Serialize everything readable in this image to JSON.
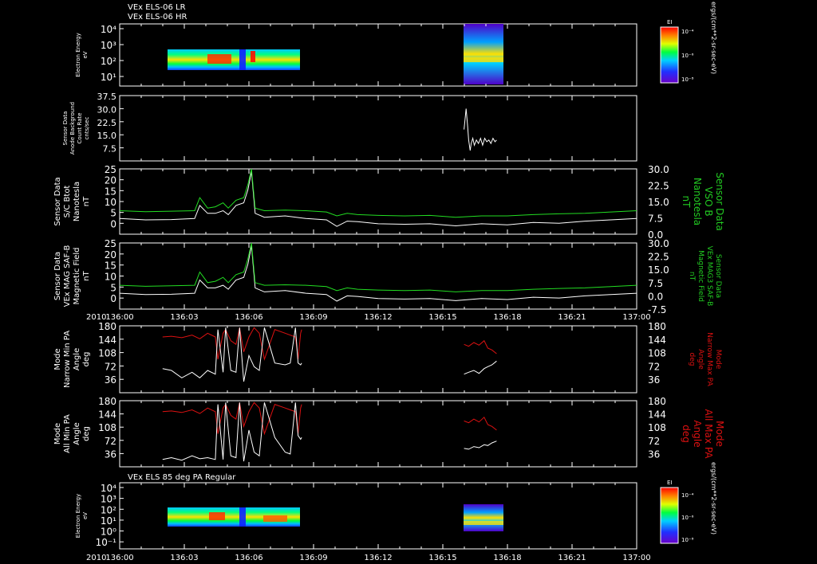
{
  "header": {
    "line1": "VEx ELS-06 LR",
    "line2": "VEx ELS-06 HR",
    "bottom_panel_title": "VEx ELS 85 deg PA Regular",
    "year": "2010"
  },
  "colors": {
    "background": "#000000",
    "axis": "#ffffff",
    "white_trace": "#ffffff",
    "green_trace": "#22dd22",
    "red_trace": "#dd1111",
    "green_label": "#22cc22",
    "red_label": "#dd1111"
  },
  "time_axis": {
    "ticks": [
      "136:00",
      "136:03",
      "136:06",
      "136:09",
      "136:12",
      "136:15",
      "136:18",
      "136:21",
      "137:00"
    ]
  },
  "colorbar": {
    "title": "EI",
    "ticks": [
      "10⁻⁴",
      "10⁻⁶",
      "10⁻⁸"
    ],
    "units": "ergs/(cm**2-sr-sec-eV)"
  },
  "chart_data": [
    {
      "type": "heatmap",
      "id": "els-lr-hr",
      "ylabel": [
        "Electron Energy",
        "eV"
      ],
      "yticks": [
        "10⁴",
        "10³",
        "10²",
        "10¹"
      ],
      "blocks": [
        {
          "t_start": 0.083,
          "t_end": 0.352,
          "note": "spectrogram segment 1"
        },
        {
          "t_start": 0.665,
          "t_end": 0.729,
          "note": "spectrogram segment 2"
        }
      ]
    },
    {
      "type": "line",
      "id": "anode-bg",
      "ylabel": [
        "Sensor Data",
        "Anode Background",
        "Count Rate",
        "cnts/sec"
      ],
      "ylim": [
        0,
        37.5
      ],
      "yticks": [
        "37.5",
        "30.0",
        "22.5",
        "15.0",
        "7.5"
      ],
      "series": [
        {
          "color": "white",
          "x": [
            0.666,
            0.668,
            0.67,
            0.673,
            0.675,
            0.678,
            0.68,
            0.683,
            0.686,
            0.69,
            0.694,
            0.698,
            0.702,
            0.706,
            0.71,
            0.714,
            0.718,
            0.722,
            0.726,
            0.729
          ],
          "y": [
            18,
            24,
            30,
            20,
            12,
            6,
            10,
            13,
            9,
            12,
            10,
            13,
            9,
            13,
            11,
            12,
            10,
            13,
            11,
            12
          ]
        }
      ]
    },
    {
      "type": "line",
      "id": "sc-bt",
      "ylabel": [
        "Sensor Data",
        "S/C Btot",
        "Nanotesla",
        "nT"
      ],
      "ylim": [
        0,
        25
      ],
      "yticks": [
        "25",
        "20",
        "15",
        "10",
        "5",
        "0"
      ],
      "ylim_right": [
        0,
        30
      ],
      "yticks_right": [
        "30.0",
        "22.5",
        "15.0",
        "7.5",
        "0.0"
      ],
      "ylabel_right": [
        "Sensor Data",
        "VSO B",
        "Nanotesla",
        "nT"
      ],
      "series": [
        {
          "color": "white",
          "x": [
            0,
            0.05,
            0.1,
            0.145,
            0.155,
            0.17,
            0.185,
            0.2,
            0.21,
            0.225,
            0.24,
            0.248,
            0.255,
            0.262,
            0.28,
            0.32,
            0.36,
            0.4,
            0.42,
            0.44,
            0.46,
            0.5,
            0.55,
            0.6,
            0.65,
            0.7,
            0.75,
            0.8,
            0.85,
            0.9,
            0.95,
            1.0
          ],
          "y": [
            6,
            5.5,
            5.6,
            6,
            11,
            8,
            8,
            9,
            7.5,
            11,
            12,
            17,
            24,
            8,
            6.5,
            7,
            6,
            5.5,
            3,
            5,
            4.8,
            4,
            3.8,
            4,
            3.2,
            4,
            3.6,
            4.5,
            4.2,
            5,
            5.5,
            6
          ]
        },
        {
          "color": "green",
          "x": [
            0,
            0.05,
            0.1,
            0.145,
            0.155,
            0.17,
            0.185,
            0.2,
            0.21,
            0.225,
            0.24,
            0.248,
            0.255,
            0.262,
            0.28,
            0.32,
            0.36,
            0.4,
            0.42,
            0.44,
            0.46,
            0.5,
            0.55,
            0.6,
            0.65,
            0.7,
            0.75,
            0.8,
            0.85,
            0.9,
            0.95,
            1.0
          ],
          "y": [
            9,
            8.6,
            8.8,
            9,
            14,
            10,
            10.5,
            12,
            10,
            13,
            14,
            19,
            25,
            10,
            9,
            9.2,
            9,
            8.5,
            7,
            8,
            7.5,
            7.2,
            7,
            7.2,
            6.5,
            7,
            7,
            7.5,
            7.8,
            8,
            8.5,
            9
          ]
        }
      ]
    },
    {
      "type": "line",
      "id": "mag-saf-b",
      "ylabel": [
        "Sensor Data",
        "VEx MAG SAF-B",
        "Magnetic Field",
        "nT"
      ],
      "ylim": [
        0,
        25
      ],
      "yticks": [
        "25",
        "20",
        "15",
        "10",
        "5",
        "0"
      ],
      "ylim_right": [
        -7.5,
        30
      ],
      "yticks_right": [
        "30.0",
        "22.5",
        "15.0",
        "7.5",
        "0.0",
        "-7.5"
      ],
      "ylabel_right": [
        "Sensor Data",
        "VEx MAG3 SAF-B",
        "Magnetic Field",
        "nT"
      ],
      "series": [
        {
          "color": "white",
          "x": [
            0,
            0.05,
            0.1,
            0.145,
            0.155,
            0.17,
            0.185,
            0.2,
            0.21,
            0.225,
            0.24,
            0.248,
            0.255,
            0.262,
            0.28,
            0.32,
            0.36,
            0.4,
            0.42,
            0.44,
            0.46,
            0.5,
            0.55,
            0.6,
            0.65,
            0.7,
            0.75,
            0.8,
            0.85,
            0.9,
            0.95,
            1.0
          ],
          "y": [
            6,
            5.5,
            5.6,
            6,
            11,
            8,
            8,
            9,
            7.5,
            11,
            12,
            17,
            24,
            8,
            6.5,
            7,
            6,
            5.5,
            3,
            5,
            4.8,
            4,
            3.8,
            4,
            3.2,
            4,
            3.6,
            4.5,
            4.2,
            5,
            5.5,
            6
          ]
        },
        {
          "color": "green",
          "x": [
            0,
            0.05,
            0.1,
            0.145,
            0.155,
            0.17,
            0.185,
            0.2,
            0.21,
            0.225,
            0.24,
            0.248,
            0.255,
            0.262,
            0.28,
            0.32,
            0.36,
            0.4,
            0.42,
            0.44,
            0.46,
            0.5,
            0.55,
            0.6,
            0.65,
            0.7,
            0.75,
            0.8,
            0.85,
            0.9,
            0.95,
            1.0
          ],
          "y": [
            9,
            8.6,
            8.8,
            9,
            14,
            10,
            10.5,
            12,
            10,
            13,
            14,
            19,
            25,
            10,
            9,
            9.2,
            9,
            8.5,
            7,
            8,
            7.5,
            7.2,
            7,
            7.2,
            6.5,
            7,
            7,
            7.5,
            7.8,
            8,
            8.5,
            9
          ]
        }
      ]
    },
    {
      "type": "line",
      "id": "narrow-pa",
      "ylabel": [
        "Mode",
        "Narrow Min PA",
        "Angle",
        "deg"
      ],
      "ylabel_right": [
        "Mode",
        "Narrow Max PA",
        "Angle",
        "deg"
      ],
      "ylim": [
        0,
        180
      ],
      "yticks": [
        "180",
        "144",
        "108",
        "72",
        "36"
      ],
      "series": [
        {
          "color": "red",
          "x": [
            0.083,
            0.1,
            0.12,
            0.14,
            0.155,
            0.17,
            0.185,
            0.19,
            0.2,
            0.205,
            0.215,
            0.225,
            0.232,
            0.24,
            0.25,
            0.26,
            0.27,
            0.28,
            0.3,
            0.32,
            0.33,
            0.34,
            0.345,
            0.35,
            0.352
          ],
          "y": [
            150,
            152,
            148,
            155,
            145,
            160,
            150,
            90,
            160,
            170,
            140,
            130,
            175,
            110,
            150,
            175,
            160,
            90,
            170,
            160,
            155,
            150,
            90,
            160,
            170
          ]
        },
        {
          "color": "white",
          "x": [
            0.083,
            0.1,
            0.12,
            0.14,
            0.155,
            0.17,
            0.185,
            0.19,
            0.2,
            0.205,
            0.215,
            0.225,
            0.232,
            0.24,
            0.25,
            0.26,
            0.27,
            0.28,
            0.3,
            0.32,
            0.33,
            0.34,
            0.345,
            0.35,
            0.352
          ],
          "y": [
            65,
            60,
            40,
            55,
            40,
            60,
            50,
            170,
            55,
            175,
            60,
            55,
            175,
            30,
            100,
            70,
            60,
            175,
            80,
            75,
            80,
            175,
            80,
            75,
            80
          ]
        },
        {
          "color": "red",
          "x": [
            0.666,
            0.675,
            0.685,
            0.695,
            0.705,
            0.712,
            0.72,
            0.729
          ],
          "y": [
            130,
            125,
            135,
            128,
            140,
            120,
            115,
            105
          ]
        },
        {
          "color": "white",
          "x": [
            0.666,
            0.675,
            0.685,
            0.695,
            0.705,
            0.712,
            0.72,
            0.729
          ],
          "y": [
            50,
            55,
            60,
            52,
            65,
            70,
            75,
            85
          ]
        }
      ]
    },
    {
      "type": "line",
      "id": "all-pa",
      "ylabel": [
        "Mode",
        "All Min PA",
        "Angle",
        "deg"
      ],
      "ylabel_right": [
        "Mode",
        "All Max PA",
        "Angle",
        "deg"
      ],
      "ylim": [
        0,
        180
      ],
      "yticks": [
        "180",
        "144",
        "108",
        "72",
        "36"
      ],
      "series": [
        {
          "color": "red",
          "x": [
            0.083,
            0.1,
            0.12,
            0.14,
            0.155,
            0.17,
            0.185,
            0.19,
            0.2,
            0.205,
            0.215,
            0.225,
            0.232,
            0.24,
            0.25,
            0.26,
            0.27,
            0.28,
            0.3,
            0.32,
            0.33,
            0.34,
            0.345,
            0.35,
            0.352
          ],
          "y": [
            150,
            152,
            148,
            155,
            145,
            160,
            150,
            90,
            160,
            170,
            140,
            130,
            175,
            110,
            150,
            175,
            160,
            90,
            170,
            160,
            155,
            150,
            90,
            160,
            170
          ]
        },
        {
          "color": "white",
          "x": [
            0.083,
            0.1,
            0.12,
            0.14,
            0.155,
            0.17,
            0.185,
            0.19,
            0.2,
            0.205,
            0.215,
            0.225,
            0.232,
            0.24,
            0.25,
            0.26,
            0.27,
            0.28,
            0.3,
            0.32,
            0.33,
            0.34,
            0.345,
            0.35,
            0.352
          ],
          "y": [
            20,
            25,
            18,
            30,
            22,
            25,
            20,
            170,
            20,
            175,
            30,
            25,
            175,
            15,
            100,
            40,
            30,
            175,
            80,
            40,
            35,
            175,
            85,
            75,
            80
          ]
        },
        {
          "color": "red",
          "x": [
            0.666,
            0.675,
            0.685,
            0.695,
            0.705,
            0.712,
            0.72,
            0.729
          ],
          "y": [
            125,
            120,
            130,
            122,
            135,
            115,
            110,
            100
          ]
        },
        {
          "color": "white",
          "x": [
            0.666,
            0.675,
            0.685,
            0.695,
            0.705,
            0.712,
            0.72,
            0.729
          ],
          "y": [
            50,
            48,
            55,
            52,
            60,
            58,
            65,
            70
          ]
        }
      ]
    },
    {
      "type": "heatmap",
      "id": "els-85deg",
      "ylabel": [
        "Electron Energy",
        "eV"
      ],
      "yticks": [
        "10⁴",
        "10³",
        "10²",
        "10¹",
        "10⁰",
        "10⁻¹"
      ],
      "blocks": [
        {
          "t_start": 0.083,
          "t_end": 0.352,
          "note": "spectrogram segment 1"
        },
        {
          "t_start": 0.665,
          "t_end": 0.729,
          "note": "spectrogram segment 2"
        }
      ]
    }
  ]
}
